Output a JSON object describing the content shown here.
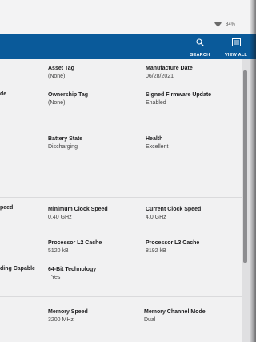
{
  "status": {
    "battery": "84%"
  },
  "appbar": {
    "search_label": "SEARCH",
    "viewall_label": "VIEW ALL"
  },
  "left_labels": [
    "de",
    "peed",
    "ding Capable"
  ],
  "fields": {
    "asset_tag": {
      "label": "Asset Tag",
      "value": "(None)"
    },
    "manufacture_date": {
      "label": "Manufacture Date",
      "value": "06/28/2021"
    },
    "ownership_tag": {
      "label": "Ownership Tag",
      "value": "(None)"
    },
    "signed_firmware": {
      "label": "Signed Firmware Update",
      "value": "Enabled"
    },
    "battery_state": {
      "label": "Battery State",
      "value": "Discharging"
    },
    "health": {
      "label": "Health",
      "value": "Excellent"
    },
    "min_clock": {
      "label": "Minimum Clock Speed",
      "value": "0.40 GHz"
    },
    "current_clock": {
      "label": "Current Clock Speed",
      "value": "4.0 GHz"
    },
    "l2_cache": {
      "label": "Processor L2 Cache",
      "value": "5120 kB"
    },
    "l3_cache": {
      "label": "Processor L3 Cache",
      "value": "8192 kB"
    },
    "bit64": {
      "label": "64-Bit Technology",
      "value": "Yes"
    },
    "memory_speed": {
      "label": "Memory Speed",
      "value": "3200 MHz"
    },
    "memory_channel": {
      "label": "Memory Channel Mode",
      "value": "Dual"
    }
  }
}
